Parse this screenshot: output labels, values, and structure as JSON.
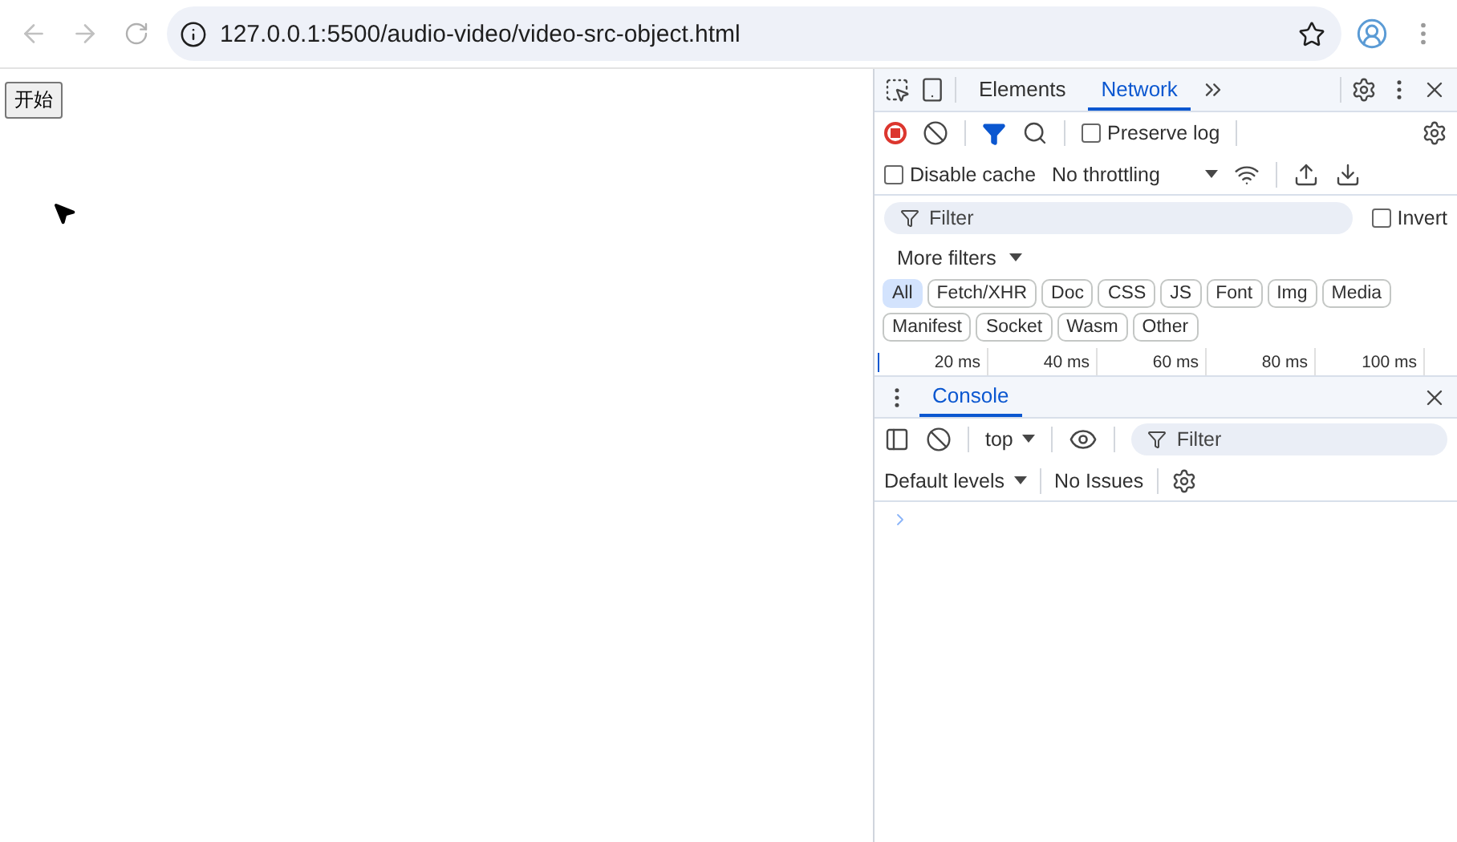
{
  "browser": {
    "url": "127.0.0.1:5500/audio-video/video-src-object.html"
  },
  "page": {
    "start_button": "开始"
  },
  "devtools": {
    "tabs": [
      {
        "label": "Elements",
        "selected": false
      },
      {
        "label": "Network",
        "selected": true
      }
    ],
    "network": {
      "recording": true,
      "preserve_log": {
        "label": "Preserve log",
        "checked": false
      },
      "disable_cache": {
        "label": "Disable cache",
        "checked": false
      },
      "throttling": "No throttling",
      "filter": {
        "placeholder": "Filter"
      },
      "invert": {
        "label": "Invert",
        "checked": false
      },
      "more_filters": "More filters",
      "type_filters": [
        {
          "label": "All",
          "selected": true
        },
        {
          "label": "Fetch/XHR",
          "selected": false
        },
        {
          "label": "Doc",
          "selected": false
        },
        {
          "label": "CSS",
          "selected": false
        },
        {
          "label": "JS",
          "selected": false
        },
        {
          "label": "Font",
          "selected": false
        },
        {
          "label": "Img",
          "selected": false
        },
        {
          "label": "Media",
          "selected": false
        },
        {
          "label": "Manifest",
          "selected": false
        },
        {
          "label": "Socket",
          "selected": false
        },
        {
          "label": "Wasm",
          "selected": false
        },
        {
          "label": "Other",
          "selected": false
        }
      ],
      "timeline_ticks": [
        "20 ms",
        "40 ms",
        "60 ms",
        "80 ms",
        "100 ms"
      ]
    },
    "drawer": {
      "tabs": [
        {
          "label": "Console",
          "selected": true
        }
      ],
      "context": "top",
      "filter": {
        "placeholder": "Filter"
      },
      "levels": "Default levels",
      "issues": "No Issues"
    }
  }
}
